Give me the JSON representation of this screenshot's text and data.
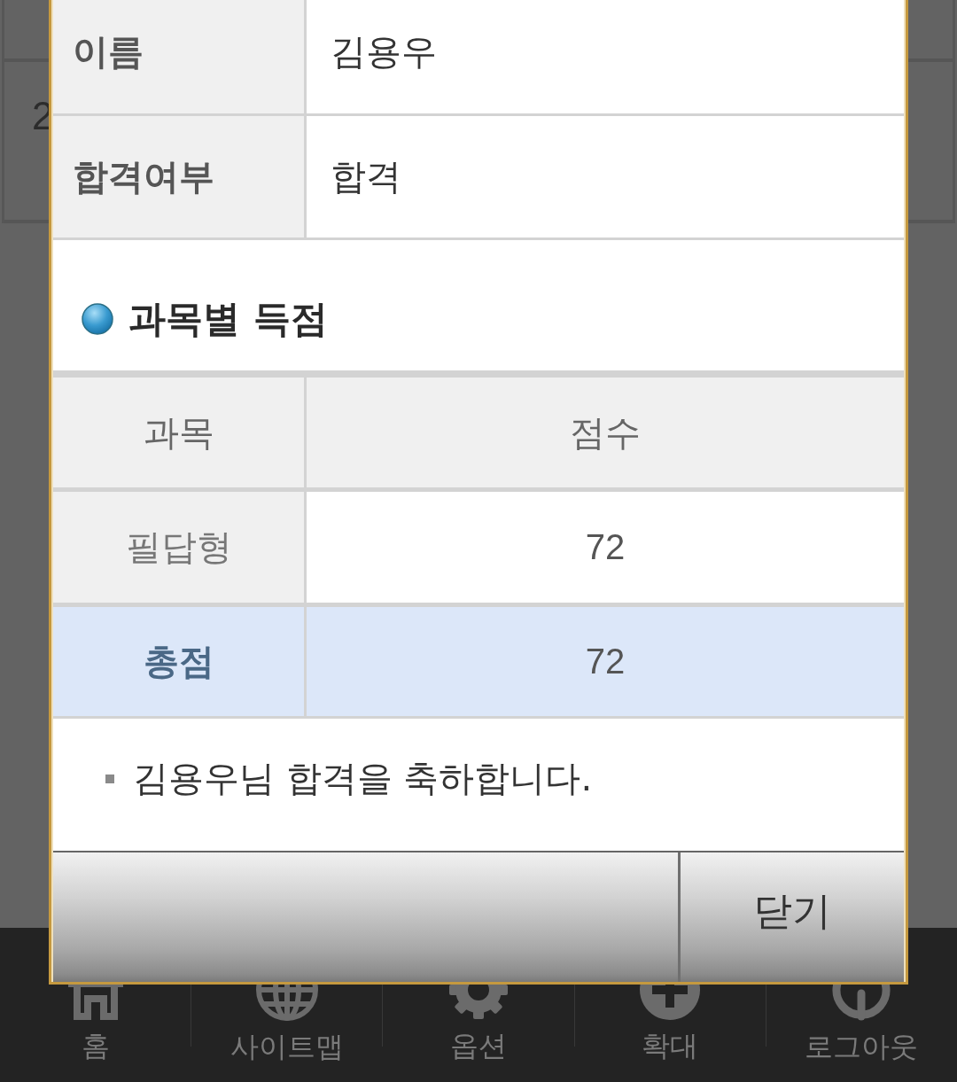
{
  "background_table": {
    "cell": "2"
  },
  "dialog": {
    "info_rows": [
      {
        "label": "이름",
        "value": "김용우"
      },
      {
        "label": "합격여부",
        "value": "합격"
      }
    ],
    "section_title": "과목별 득점",
    "score_table": {
      "columns": [
        "과목",
        "점수"
      ],
      "rows": [
        {
          "kind": "subject",
          "subject": "필답형",
          "score": "72"
        },
        {
          "kind": "total",
          "subject": "총점",
          "score": "72"
        }
      ]
    },
    "message": "김용우님 합격을 축하합니다.",
    "buttons": [
      {
        "kind": "blank"
      },
      {
        "kind": "close",
        "label": "닫기"
      }
    ]
  },
  "bottom_nav": {
    "items": [
      {
        "kind": "home",
        "label": "홈"
      },
      {
        "kind": "globe",
        "label": "사이트맵"
      },
      {
        "kind": "gear",
        "label": "옵션"
      },
      {
        "kind": "plus",
        "label": "확대"
      },
      {
        "kind": "power",
        "label": "로그아웃"
      }
    ]
  }
}
